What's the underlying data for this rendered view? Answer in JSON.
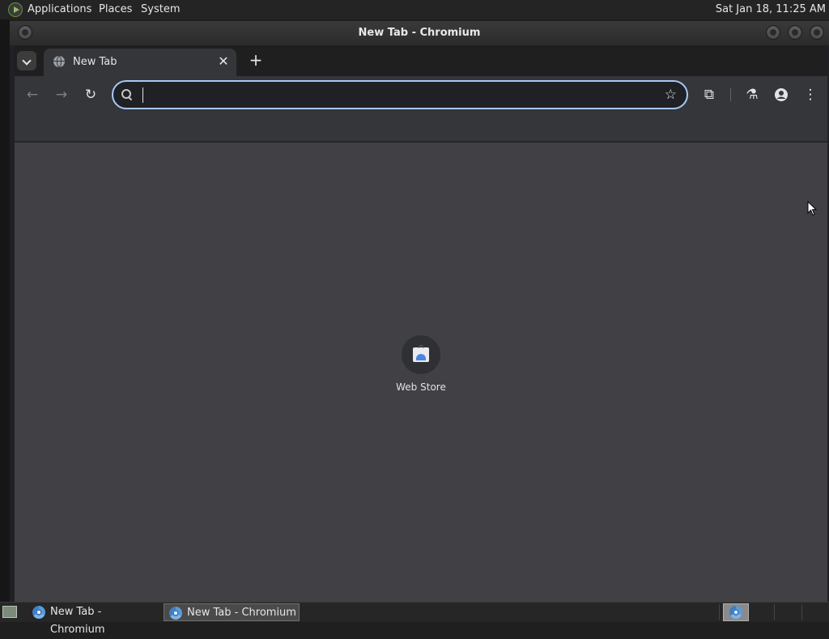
{
  "top_panel": {
    "menus": [
      "Applications",
      "Places",
      "System"
    ],
    "clock": "Sat Jan 18, 11:25 AM"
  },
  "window": {
    "title": "New Tab - Chromium"
  },
  "tabs": [
    {
      "label": "New Tab",
      "close_glyph": "✕"
    }
  ],
  "new_tab_glyph": "+",
  "toolbar": {
    "back_glyph": "←",
    "forward_glyph": "→",
    "reload_glyph": "↻",
    "bookmark_glyph": "☆",
    "extensions_glyph": "⧉",
    "labs_glyph": "⚗",
    "profile_glyph": "●",
    "menu_glyph": "⋮"
  },
  "omnibox": {
    "value": "",
    "placeholder": ""
  },
  "shortcuts": [
    {
      "label": "Web Store",
      "icon": "web-store-icon"
    }
  ],
  "taskbar": {
    "items": [
      {
        "label": "New Tab - Chromium",
        "active": false
      },
      {
        "label": "New Tab - Chromium",
        "active": true
      }
    ]
  },
  "colors": {
    "omnibox_focus": "#a8c7fa",
    "content_bg": "#404045",
    "toolbar_bg": "#35363a"
  }
}
